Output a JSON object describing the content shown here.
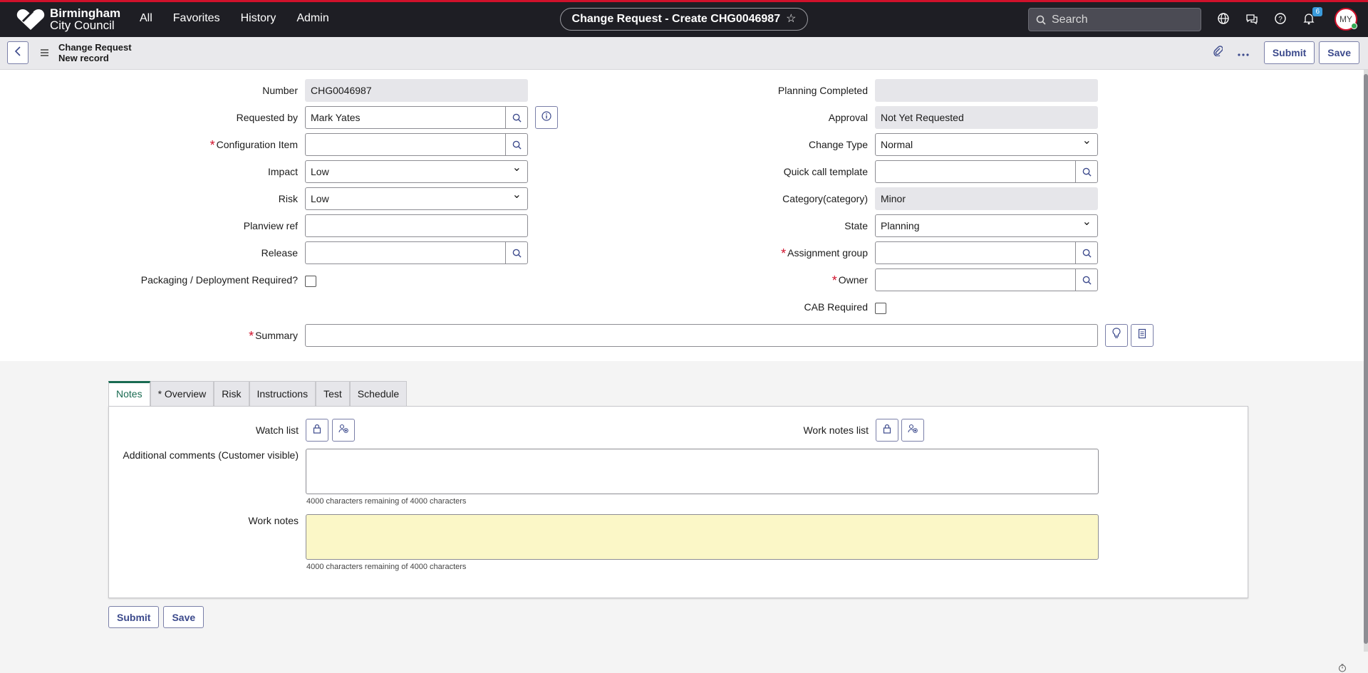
{
  "brand": {
    "line1": "Birmingham",
    "line2": "City Council"
  },
  "nav": {
    "items": [
      "All",
      "Favorites",
      "History",
      "Admin"
    ]
  },
  "header": {
    "title": "Change Request - Create CHG0046987",
    "star": "☆"
  },
  "search": {
    "placeholder": "Search"
  },
  "notifications": {
    "count": "6"
  },
  "user": {
    "initials": "MY"
  },
  "record": {
    "type": "Change Request",
    "status": "New record"
  },
  "actions": {
    "submit": "Submit",
    "save": "Save"
  },
  "left_fields": {
    "number": {
      "label": "Number",
      "value": "CHG0046987"
    },
    "requested_by": {
      "label": "Requested by",
      "value": "Mark Yates"
    },
    "configuration_item": {
      "label": "Configuration Item",
      "value": ""
    },
    "impact": {
      "label": "Impact",
      "value": "Low"
    },
    "risk": {
      "label": "Risk",
      "value": "Low"
    },
    "planview_ref": {
      "label": "Planview ref",
      "value": ""
    },
    "release": {
      "label": "Release",
      "value": ""
    },
    "packaging": {
      "label": "Packaging / Deployment Required?"
    }
  },
  "right_fields": {
    "planning_completed": {
      "label": "Planning Completed",
      "value": ""
    },
    "approval": {
      "label": "Approval",
      "value": "Not Yet Requested"
    },
    "change_type": {
      "label": "Change Type",
      "value": "Normal"
    },
    "quick_call": {
      "label": "Quick call template",
      "value": ""
    },
    "category": {
      "label": "Category(category)",
      "value": "Minor"
    },
    "state": {
      "label": "State",
      "value": "Planning"
    },
    "assignment_group": {
      "label": "Assignment group",
      "value": ""
    },
    "owner": {
      "label": "Owner",
      "value": ""
    },
    "cab_required": {
      "label": "CAB Required"
    }
  },
  "summary": {
    "label": "Summary",
    "value": ""
  },
  "tabs": [
    "Notes",
    "* Overview",
    "Risk",
    "Instructions",
    "Test",
    "Schedule"
  ],
  "notes": {
    "watch_list": "Watch list",
    "work_notes_list": "Work notes list",
    "additional_comments": "Additional comments (Customer visible)",
    "additional_hint": "4000 characters remaining of 4000 characters",
    "work_notes": "Work notes",
    "work_notes_hint": "4000 characters remaining of 4000 characters"
  },
  "colors": {
    "brand_red": "#d0112b",
    "nav_bg": "#1e1e24",
    "accent": "#3c4a8c",
    "active_tab": "#1a6b52"
  }
}
